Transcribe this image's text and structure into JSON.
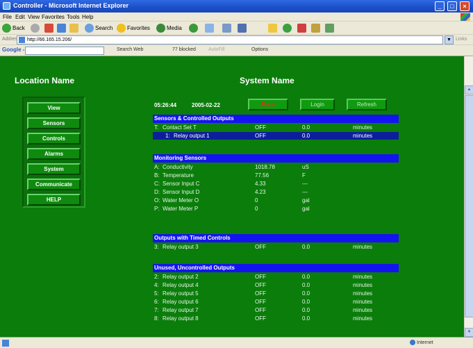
{
  "window": {
    "title": "Controller - Microsoft Internet Explorer"
  },
  "menu": [
    "File",
    "Edit",
    "View",
    "Favorites",
    "Tools",
    "Help"
  ],
  "toolbar": {
    "back": "Back",
    "search": "Search",
    "favorites": "Favorites",
    "media": "Media"
  },
  "address": {
    "label": "Address",
    "url": "http://66.165.15.206/",
    "go": "Links"
  },
  "google_bar": {
    "logo": "Google -",
    "search_web": "Search Web",
    "blocked": "77 blocked",
    "autofill": "AutoFill",
    "options": "Options"
  },
  "page": {
    "location_name": "Location Name",
    "system_name": "System Name",
    "time": "05:26:44",
    "date": "2005-02-22",
    "buttons": {
      "alarm": "Alarm",
      "login": "Login",
      "refresh": "Refresh"
    },
    "nav": [
      "View",
      "Sensors",
      "Controls",
      "Alarms",
      "System",
      "Communicate",
      "HELP"
    ],
    "sections": {
      "sensors_controlled": {
        "title": "Sensors & Controlled Outputs",
        "rows": [
          {
            "id": "T:",
            "name": "Contact Set T",
            "value": "OFF",
            "setting": "0.0",
            "unit": "minutes"
          },
          {
            "id": "1:",
            "name": "Relay output 1",
            "value": "OFF",
            "setting": "0.0",
            "unit": "minutes"
          }
        ]
      },
      "monitoring": {
        "title": "Monitoring Sensors",
        "rows": [
          {
            "id": "A:",
            "name": "Conductivity",
            "value": "1018.78",
            "unit": "uS"
          },
          {
            "id": "B:",
            "name": "Temperature",
            "value": "77.56",
            "unit": "F"
          },
          {
            "id": "C:",
            "name": "Sensor Input C",
            "value": "4.33",
            "unit": "---"
          },
          {
            "id": "D:",
            "name": "Sensor Input D",
            "value": "4.23",
            "unit": "---"
          },
          {
            "id": "O:",
            "name": "Water Meter O",
            "value": "0",
            "unit": "gal"
          },
          {
            "id": "P:",
            "name": "Water Meter P",
            "value": "0",
            "unit": "gal"
          }
        ]
      },
      "timed": {
        "title": "Outputs with Timed Controls",
        "rows": [
          {
            "id": "3:",
            "name": "Relay output 3",
            "value": "OFF",
            "setting": "0.0",
            "unit": "minutes"
          }
        ]
      },
      "unused": {
        "title": "Unused, Uncontrolled Outputs",
        "rows": [
          {
            "id": "2:",
            "name": "Relay output 2",
            "value": "OFF",
            "setting": "0.0",
            "unit": "minutes"
          },
          {
            "id": "4:",
            "name": "Relay output 4",
            "value": "OFF",
            "setting": "0.0",
            "unit": "minutes"
          },
          {
            "id": "5:",
            "name": "Relay output 5",
            "value": "OFF",
            "setting": "0.0",
            "unit": "minutes"
          },
          {
            "id": "6:",
            "name": "Relay output 6",
            "value": "OFF",
            "setting": "0.0",
            "unit": "minutes"
          },
          {
            "id": "7:",
            "name": "Relay output 7",
            "value": "OFF",
            "setting": "0.0",
            "unit": "minutes"
          },
          {
            "id": "8:",
            "name": "Relay output 8",
            "value": "OFF",
            "setting": "0.0",
            "unit": "minutes"
          }
        ]
      }
    }
  },
  "status": {
    "zone": "Internet"
  },
  "colors": {
    "page_bg": "#0b7d0b",
    "section_header": "#1414f2",
    "selected_row": "#0c1f9a",
    "alarm_text": "#ff2020"
  }
}
